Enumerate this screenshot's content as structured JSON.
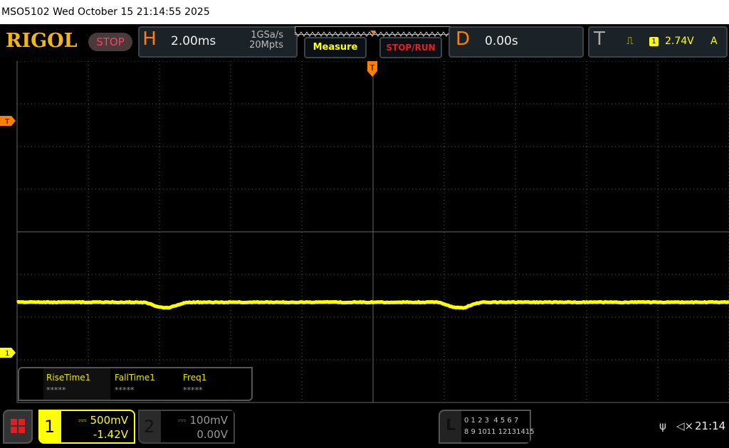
{
  "title_bar": "MSO5102  Wed October 15 21:14:55 2025",
  "logo": "RIGOL",
  "run_state": "STOP",
  "horizontal": {
    "letter": "H",
    "timebase": "2.00ms",
    "sample_rate": "1GSa/s",
    "memory_depth": "20Mpts"
  },
  "buttons": {
    "measure": "Measure",
    "stop_run": "STOP/RUN"
  },
  "delay": {
    "letter": "D",
    "value": "0.00s"
  },
  "trigger": {
    "letter": "T",
    "edge_icon": "rising-edge-icon",
    "source": "1",
    "level": "2.74V",
    "mode": "A"
  },
  "markers": {
    "trigger_pos": "T",
    "trigger_level": "T",
    "ch1": "1"
  },
  "measurements": [
    {
      "name": "RiseTime1",
      "value": "*****"
    },
    {
      "name": "FallTime1",
      "value": "*****"
    },
    {
      "name": "Freq1",
      "value": "*****"
    }
  ],
  "channels": [
    {
      "number": "1",
      "scale": "500mV",
      "offset": "-1.42V",
      "color": "#ffff00",
      "active": true
    },
    {
      "number": "2",
      "scale": "100mV",
      "offset": "0.00V",
      "color": "#888888",
      "active": false
    }
  ],
  "logic": {
    "letter": "L",
    "row1": "0 1 2 3  4 5 6 7",
    "row2": "8 9 1011 12131415"
  },
  "status": {
    "usb_icon": "usb-icon",
    "sound_icon": "speaker-muted-icon",
    "clock": "21:14"
  },
  "colors": {
    "trace": "#ffff00",
    "accent": "#ff7f00",
    "grid": "#555555"
  }
}
